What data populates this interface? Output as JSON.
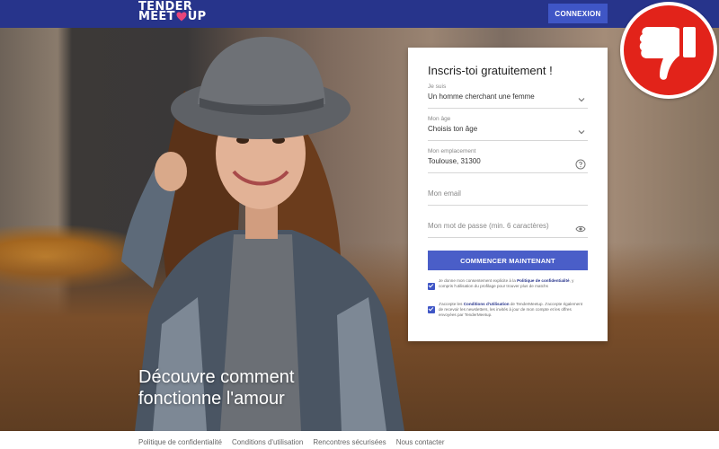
{
  "header": {
    "logo_line1": "TENDER",
    "logo_line2a": "MEET",
    "logo_line2b": "UP",
    "login_label": "CONNEXION"
  },
  "hero": {
    "title_line1": "Découvre comment",
    "title_line2": "fonctionne l'amour"
  },
  "form": {
    "title": "Inscris-toi gratuitement !",
    "fields": [
      {
        "label": "Je suis",
        "value": "Un homme cherchant une femme",
        "icon": "chevron-down-icon"
      },
      {
        "label": "Mon âge",
        "value": "Choisis ton âge",
        "icon": "chevron-down-icon"
      },
      {
        "label": "Mon emplacement",
        "value": "Toulouse, 31300",
        "icon": "help-circle-icon"
      },
      {
        "placeholder": "Mon email"
      },
      {
        "placeholder": "Mon mot de passe (min. 6 caractères)",
        "icon": "eye-icon"
      }
    ],
    "submit_label": "COMMENCER MAINTENANT",
    "consent1_a": "Je donne mon consentement explicite à la",
    "consent1_link": "Politique de confidentialité",
    "consent1_b": ", y compris l'utilisation du profilage pour trouver plus de matchs",
    "consent2_a": "J'accepte les",
    "consent2_link": "Conditions d'utilisation",
    "consent2_b": "de TenderMeetup. J'accepte également de recevoir les newsletters, les invités à jour de mon compte et les offres envoyées par TenderMeetup."
  },
  "badge": {
    "icon": "thumbs-down-icon",
    "color": "#e2231a"
  },
  "footer": {
    "links": [
      "Politique de confidentialité",
      "Conditions d'utilisation",
      "Rencontres sécurisées",
      "Nous contacter"
    ]
  },
  "colors": {
    "header": "#27348b",
    "accent": "#4a5ec8"
  }
}
